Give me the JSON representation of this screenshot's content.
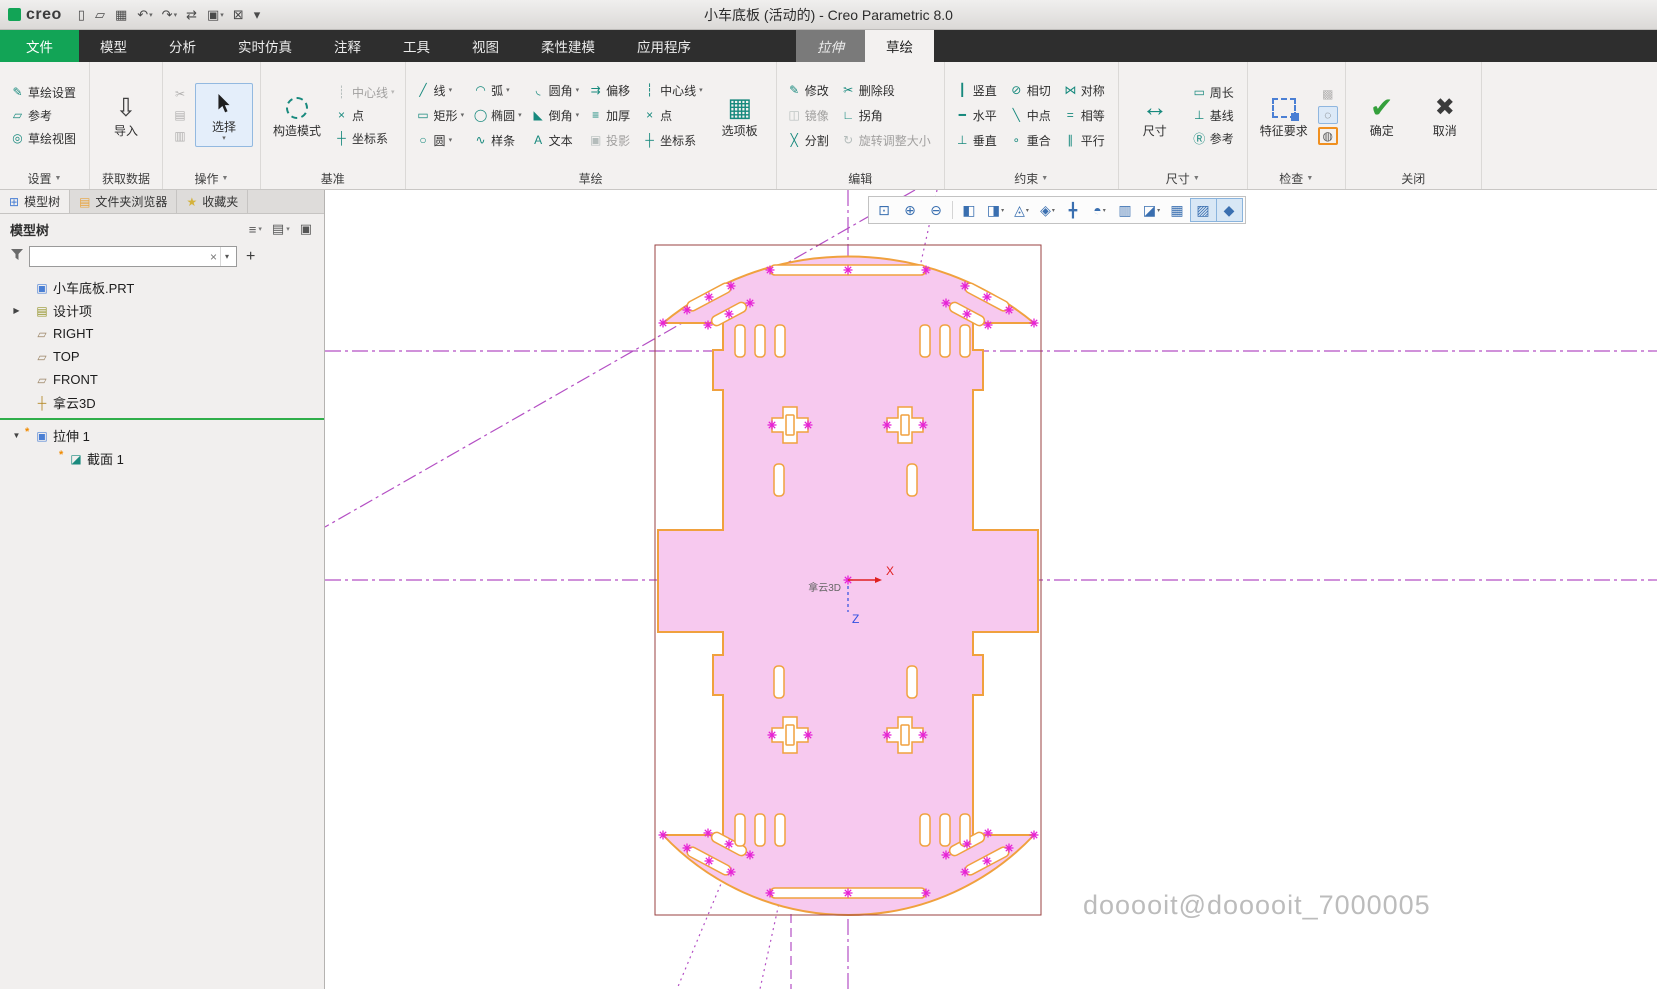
{
  "colors": {
    "accent-green": "#12a456",
    "tabbar-bg": "#2e2e2e",
    "contextual-tab-bg": "#7a7a7a",
    "ribbon-bg": "#f3f1f0",
    "icon-teal": "#17897d",
    "sketch-fill": "#f7c9ef",
    "sketch-stroke": "#f0a13e",
    "centerline-purple": "#b44fc4",
    "handle-magenta": "#e623d6",
    "selection-border": "#9a4242",
    "axis-x-red": "#e02020",
    "axis-z-blue": "#3050e0",
    "insert-line-green": "#2fae4a",
    "watermark-gray": "#bcbcbc"
  },
  "titlebar": {
    "logo_text": "creo",
    "title": "小车底板 (活动的) - Creo Parametric 8.0",
    "quick_access": [
      {
        "name": "new-file-button",
        "glyph": "▯",
        "arrow": ""
      },
      {
        "name": "open-file-button",
        "glyph": "▱",
        "arrow": ""
      },
      {
        "name": "save-button",
        "glyph": "▦",
        "arrow": ""
      },
      {
        "name": "undo-button",
        "glyph": "↶",
        "arrow": "▾"
      },
      {
        "name": "redo-button",
        "glyph": "↷",
        "arrow": "▾"
      },
      {
        "name": "regenerate-button",
        "glyph": "⇄",
        "arrow": ""
      },
      {
        "name": "window-button",
        "glyph": "▣",
        "arrow": "▾"
      },
      {
        "name": "close-window-button",
        "glyph": "⊠",
        "arrow": ""
      },
      {
        "name": "customize-quick-access-button",
        "glyph": "▾",
        "arrow": ""
      }
    ]
  },
  "tabs": [
    {
      "name": "tab-file",
      "label": "文件",
      "cls": "file"
    },
    {
      "name": "tab-model",
      "label": "模型",
      "cls": ""
    },
    {
      "name": "tab-analysis",
      "label": "分析",
      "cls": ""
    },
    {
      "name": "tab-live-simulation",
      "label": "实时仿真",
      "cls": ""
    },
    {
      "name": "tab-annotate",
      "label": "注释",
      "cls": ""
    },
    {
      "name": "tab-tools",
      "label": "工具",
      "cls": ""
    },
    {
      "name": "tab-view",
      "label": "视图",
      "cls": ""
    },
    {
      "name": "tab-flexible-modeling",
      "label": "柔性建模",
      "cls": ""
    },
    {
      "name": "tab-applications",
      "label": "应用程序",
      "cls": ""
    },
    {
      "name": "tab-extrude",
      "label": "拉伸",
      "cls": "contextual"
    },
    {
      "name": "tab-sketch",
      "label": "草绘",
      "cls": "active"
    }
  ],
  "ribbon": {
    "setup": {
      "buttons": [
        {
          "name": "sketch-setup-button",
          "icon": "✎",
          "label": "草绘设置",
          "arrow": "",
          "cls": ""
        },
        {
          "name": "references-button",
          "icon": "▱",
          "label": "参考",
          "arrow": "",
          "cls": ""
        },
        {
          "name": "sketch-view-button",
          "icon": "◎",
          "label": "草绘视图",
          "arrow": "",
          "cls": ""
        }
      ],
      "footer": "设置",
      "footer_arrow": "▼"
    },
    "get_data": {
      "import_button": {
        "icon": "⇩",
        "label": "导入"
      },
      "footer": "获取数据",
      "footer_arrow": ""
    },
    "operations": {
      "clipboard": [
        {
          "name": "cut-button",
          "icon": "✂",
          "cls": "disabled"
        },
        {
          "name": "copy-button",
          "icon": "▤",
          "cls": "disabled"
        },
        {
          "name": "paste-button",
          "icon": "▥",
          "cls": "disabled"
        }
      ],
      "select_button": {
        "label": "选择",
        "arrow": "▾"
      },
      "footer": "操作",
      "footer_arrow": "▼"
    },
    "datum": {
      "construction_button": {
        "label": "构造模式"
      },
      "buttons": [
        {
          "name": "centerline-datum-button",
          "icon": "┊",
          "label": "中心线",
          "arrow": "▾",
          "cls": "disabled"
        },
        {
          "name": "point-datum-button",
          "icon": "×",
          "label": "点",
          "arrow": "",
          "cls": ""
        },
        {
          "name": "csys-datum-button",
          "icon": "┼",
          "label": "坐标系",
          "arrow": "",
          "cls": ""
        }
      ],
      "footer": "基准",
      "footer_arrow": ""
    },
    "sketch": {
      "buttons": [
        {
          "name": "line-button",
          "icon": "╱",
          "label": "线",
          "arrow": "▾",
          "cls": ""
        },
        {
          "name": "rectangle-button",
          "icon": "▭",
          "label": "矩形",
          "arrow": "▾",
          "cls": ""
        },
        {
          "name": "circle-button",
          "icon": "○",
          "label": "圆",
          "arrow": "▾",
          "cls": ""
        },
        {
          "name": "arc-button",
          "icon": "◠",
          "label": "弧",
          "arrow": "▾",
          "cls": ""
        },
        {
          "name": "ellipse-button",
          "icon": "◯",
          "label": "椭圆",
          "arrow": "▾",
          "cls": ""
        },
        {
          "name": "spline-button",
          "icon": "∿",
          "label": "样条",
          "arrow": "",
          "cls": ""
        },
        {
          "name": "fillet-button",
          "icon": "◟",
          "label": "圆角",
          "arrow": "▾",
          "cls": ""
        },
        {
          "name": "chamfer-button",
          "icon": "◣",
          "label": "倒角",
          "arrow": "▾",
          "cls": ""
        },
        {
          "name": "text-button",
          "icon": "A",
          "label": "文本",
          "arrow": "",
          "cls": ""
        },
        {
          "name": "offset-button",
          "icon": "⇉",
          "label": "偏移",
          "arrow": "",
          "cls": ""
        },
        {
          "name": "thicken-button",
          "icon": "≡",
          "label": "加厚",
          "arrow": "",
          "cls": ""
        },
        {
          "name": "project-button",
          "icon": "▣",
          "label": "投影",
          "arrow": "",
          "cls": "disabled"
        },
        {
          "name": "centerline-button",
          "icon": "┆",
          "label": "中心线",
          "arrow": "▾",
          "cls": ""
        },
        {
          "name": "point-button",
          "icon": "×",
          "label": "点",
          "arrow": "",
          "cls": ""
        },
        {
          "name": "csys-button",
          "icon": "┼",
          "label": "坐标系",
          "arrow": "",
          "cls": ""
        }
      ],
      "palette_button": {
        "icon": "▦",
        "label": "选项板"
      },
      "footer": "草绘",
      "footer_arrow": ""
    },
    "editing": {
      "buttons": [
        {
          "name": "modify-button",
          "icon": "✎",
          "label": "修改",
          "arrow": "",
          "cls": ""
        },
        {
          "name": "mirror-button",
          "icon": "◫",
          "label": "镜像",
          "arrow": "",
          "cls": "disabled"
        },
        {
          "name": "divide-button",
          "icon": "╳",
          "label": "分割",
          "arrow": "",
          "cls": ""
        },
        {
          "name": "delete-segment-button",
          "icon": "✂",
          "label": "删除段",
          "arrow": "",
          "cls": ""
        },
        {
          "name": "corner-button",
          "icon": "∟",
          "label": "拐角",
          "arrow": "",
          "cls": ""
        },
        {
          "name": "rotate-resize-button",
          "icon": "↻",
          "label": "旋转调整大小",
          "arrow": "",
          "cls": "disabled"
        }
      ],
      "footer": "编辑",
      "footer_arrow": ""
    },
    "constrain": {
      "buttons": [
        {
          "name": "vertical-constraint-button",
          "icon": "┃",
          "label": "竖直",
          "arrow": "",
          "cls": ""
        },
        {
          "name": "horizontal-constraint-button",
          "icon": "━",
          "label": "水平",
          "arrow": "",
          "cls": ""
        },
        {
          "name": "perpendicular-constraint-button",
          "icon": "⊥",
          "label": "垂直",
          "arrow": "",
          "cls": ""
        },
        {
          "name": "tangent-constraint-button",
          "icon": "⊘",
          "label": "相切",
          "arrow": "",
          "cls": ""
        },
        {
          "name": "midpoint-constraint-button",
          "icon": "╲",
          "label": "中点",
          "arrow": "",
          "cls": ""
        },
        {
          "name": "coincident-constraint-button",
          "icon": "∘",
          "label": "重合",
          "arrow": "",
          "cls": ""
        },
        {
          "name": "symmetric-constraint-button",
          "icon": "⋈",
          "label": "对称",
          "arrow": "",
          "cls": ""
        },
        {
          "name": "equal-constraint-button",
          "icon": "=",
          "label": "相等",
          "arrow": "",
          "cls": ""
        },
        {
          "name": "parallel-constraint-button",
          "icon": "∥",
          "label": "平行",
          "arrow": "",
          "cls": ""
        }
      ],
      "footer": "约束",
      "footer_arrow": "▼"
    },
    "dimension": {
      "main_button": {
        "icon": "↔",
        "label": "尺寸"
      },
      "buttons": [
        {
          "name": "perimeter-dimension-button",
          "icon": "▭",
          "label": "周长",
          "arrow": "",
          "cls": ""
        },
        {
          "name": "baseline-dimension-button",
          "icon": "⊥",
          "label": "基线",
          "arrow": "",
          "cls": ""
        },
        {
          "name": "reference-dimension-button",
          "icon": "Ⓡ",
          "label": "参考",
          "arrow": "",
          "cls": ""
        }
      ],
      "footer": "尺寸",
      "footer_arrow": "▼"
    },
    "inspect": {
      "main_button": {
        "label": "特征要求"
      },
      "icons": [
        {
          "name": "shade-closed-loops-button",
          "icon": "▩",
          "cls": "disabled"
        },
        {
          "name": "highlight-open-ends-button",
          "icon": "◌",
          "cls": "pressed"
        },
        {
          "name": "overlapping-geometry-button",
          "icon": "◍",
          "cls": "active-orange"
        }
      ],
      "footer": "检查",
      "footer_arrow": "▼"
    },
    "close": {
      "ok_button": {
        "icon": "✔",
        "label": "确定"
      },
      "cancel_button": {
        "icon": "✖",
        "label": "取消"
      },
      "footer": "关闭",
      "footer_arrow": ""
    }
  },
  "left_panel": {
    "tabs": [
      {
        "name": "panel-tab-model-tree",
        "icon": "⊞",
        "iconcls": "ic-tree",
        "label": "模型树",
        "cls": "active"
      },
      {
        "name": "panel-tab-folder-browser",
        "icon": "▤",
        "iconcls": "ic-folder",
        "label": "文件夹浏览器",
        "cls": ""
      },
      {
        "name": "panel-tab-favorites",
        "icon": "★",
        "iconcls": "ic-fav",
        "label": "收藏夹",
        "cls": ""
      }
    ],
    "tree_header": {
      "title": "模型树",
      "icons": [
        {
          "name": "tree-settings-button",
          "glyph": "≡",
          "arrow": "▾"
        },
        {
          "name": "tree-display-options-button",
          "glyph": "▤",
          "arrow": "▾"
        },
        {
          "name": "tree-detach-button",
          "glyph": "▣",
          "arrow": ""
        }
      ]
    },
    "filter": {
      "value": "",
      "clear_glyph": "×",
      "dropdown_glyph": "▾",
      "add_glyph": "+"
    },
    "tree_top": [
      {
        "name": "tree-item-part",
        "arrow": "",
        "badge": "",
        "icon": "▣",
        "iconcls": "ic-part",
        "label": "小车底板.PRT",
        "cls": ""
      },
      {
        "name": "tree-item-design-items",
        "arrow": "▶",
        "badge": "",
        "icon": "▤",
        "iconcls": "ic-design",
        "label": "设计项",
        "cls": ""
      },
      {
        "name": "tree-item-right-plane",
        "arrow": "",
        "badge": "",
        "icon": "▱",
        "iconcls": "ic-plane",
        "label": "RIGHT",
        "cls": ""
      },
      {
        "name": "tree-item-top-plane",
        "arrow": "",
        "badge": "",
        "icon": "▱",
        "iconcls": "ic-plane",
        "label": "TOP",
        "cls": ""
      },
      {
        "name": "tree-item-front-plane",
        "arrow": "",
        "badge": "",
        "icon": "▱",
        "iconcls": "ic-plane",
        "label": "FRONT",
        "cls": ""
      },
      {
        "name": "tree-item-csys",
        "arrow": "",
        "badge": "",
        "icon": "┼",
        "iconcls": "ic-csys",
        "label": "拿云3D",
        "cls": ""
      }
    ],
    "tree_bottom": [
      {
        "name": "tree-item-extrude-1",
        "arrow": "▼",
        "badge": "*",
        "icon": "▣",
        "iconcls": "ic-extrude",
        "label": "拉伸 1",
        "cls": ""
      },
      {
        "name": "tree-item-section-1",
        "arrow": "",
        "badge": "*",
        "icon": "◪",
        "iconcls": "ic-section",
        "label": "截面 1",
        "cls": "indent"
      }
    ]
  },
  "canvas": {
    "toolbar": [
      {
        "name": "zoom-window-button",
        "glyph": "⊡",
        "arrow": "",
        "cls": ""
      },
      {
        "name": "zoom-in-button",
        "glyph": "⊕",
        "arrow": "",
        "cls": ""
      },
      {
        "name": "zoom-out-button",
        "glyph": "⊖",
        "arrow": "",
        "cls": ""
      },
      {
        "name": "redraw-button",
        "glyph": "◧",
        "arrow": "",
        "cls": "group-start"
      },
      {
        "name": "display-style-button",
        "glyph": "◨",
        "arrow": "▾",
        "cls": ""
      },
      {
        "name": "datum-display-button",
        "glyph": "◬",
        "arrow": "▾",
        "cls": ""
      },
      {
        "name": "annotation-display-button",
        "glyph": "◈",
        "arrow": "▾",
        "cls": ""
      },
      {
        "name": "spin-center-button",
        "glyph": "╋",
        "arrow": "",
        "cls": ""
      },
      {
        "name": "orientation-button",
        "glyph": "◓",
        "arrow": "▾",
        "cls": ""
      },
      {
        "name": "view-manager-button",
        "glyph": "▥",
        "arrow": "",
        "cls": ""
      },
      {
        "name": "section-view-button",
        "glyph": "◪",
        "arrow": "▾",
        "cls": ""
      },
      {
        "name": "snap-to-grid-button",
        "glyph": "▦",
        "arrow": "",
        "cls": ""
      },
      {
        "name": "sketch-display-button",
        "glyph": "▨",
        "arrow": "",
        "cls": "active"
      },
      {
        "name": "sketch-orientation-button",
        "glyph": "◆",
        "arrow": "",
        "cls": "active"
      }
    ],
    "axis_x": "X",
    "axis_z": "Z",
    "csys_label": "拿云3D",
    "watermark": "dooooit@dooooit_7000005"
  }
}
